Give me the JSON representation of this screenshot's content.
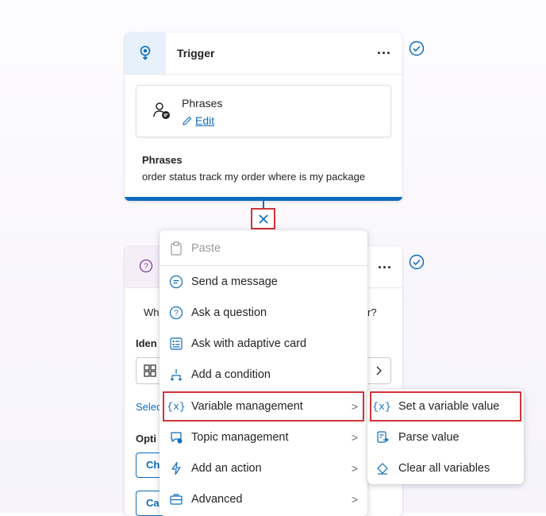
{
  "trigger": {
    "title": "Trigger",
    "more": "...",
    "phrases_title": "Phrases",
    "edit_label": "Edit",
    "phrases_label": "Phrases",
    "phrases_text": "order status track my order where is my package"
  },
  "question_card": {
    "more": "...",
    "partial_question_left": "Wh",
    "partial_question_right": "r?",
    "partial_identify": "Iden",
    "partial_select": "Selec",
    "partial_options": "Opti",
    "partial_btn1": "Ch",
    "partial_btn2": "Ca"
  },
  "main_menu": {
    "items": [
      {
        "label": "Paste",
        "icon": "paste-icon",
        "disabled": true
      },
      {
        "label": "Send a message",
        "icon": "chat-icon"
      },
      {
        "label": "Ask a question",
        "icon": "question-icon"
      },
      {
        "label": "Ask with adaptive card",
        "icon": "card-icon"
      },
      {
        "label": "Add a condition",
        "icon": "branch-icon"
      },
      {
        "label": "Variable management",
        "icon": "variable-icon",
        "submenu": true,
        "highlighted": true
      },
      {
        "label": "Topic management",
        "icon": "topic-icon",
        "submenu": true
      },
      {
        "label": "Add an action",
        "icon": "action-icon",
        "submenu": true
      },
      {
        "label": "Advanced",
        "icon": "briefcase-icon",
        "submenu": true
      }
    ]
  },
  "sub_menu": {
    "items": [
      {
        "label": "Set a variable value",
        "icon": "variable-icon",
        "highlighted": true
      },
      {
        "label": "Parse value",
        "icon": "parse-icon"
      },
      {
        "label": "Clear all variables",
        "icon": "eraser-icon"
      }
    ]
  },
  "colors": {
    "accent": "#0f6cbd",
    "highlight": "#d13438",
    "success": "#0f6cbd"
  }
}
